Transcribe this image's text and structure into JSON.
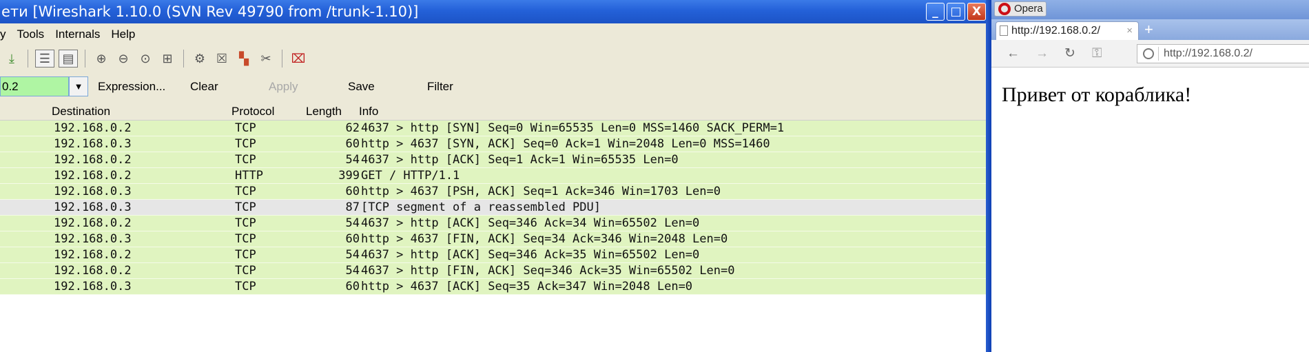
{
  "wireshark": {
    "title": "ети   [Wireshark 1.10.0  (SVN Rev 49790 from /trunk-1.10)]",
    "window_buttons": [
      "_",
      "□",
      "X"
    ],
    "menu": [
      "y",
      "Tools",
      "Internals",
      "Help"
    ],
    "filter": {
      "value": "0.2",
      "buttons": {
        "expression": "Expression...",
        "clear": "Clear",
        "apply": "Apply",
        "save": "Save",
        "filter": "Filter"
      }
    },
    "columns": {
      "destination": "Destination",
      "protocol": "Protocol",
      "length": "Length",
      "info": "Info"
    },
    "packets": [
      {
        "dst": "192.168.0.2",
        "proto": "TCP",
        "len": "62",
        "info": "4637 > http [SYN] Seq=0 Win=65535 Len=0 MSS=1460 SACK_PERM=1"
      },
      {
        "dst": "192.168.0.3",
        "proto": "TCP",
        "len": "60",
        "info": "http > 4637 [SYN, ACK] Seq=0 Ack=1 Win=2048 Len=0 MSS=1460"
      },
      {
        "dst": "192.168.0.2",
        "proto": "TCP",
        "len": "54",
        "info": "4637 > http [ACK] Seq=1 Ack=1 Win=65535 Len=0"
      },
      {
        "dst": "192.168.0.2",
        "proto": "HTTP",
        "len": "399",
        "info": "GET / HTTP/1.1"
      },
      {
        "dst": "192.168.0.3",
        "proto": "TCP",
        "len": "60",
        "info": "http > 4637 [PSH, ACK] Seq=1 Ack=346 Win=1703 Len=0"
      },
      {
        "dst": "192.168.0.3",
        "proto": "TCP",
        "len": "87",
        "info": "[TCP segment of a reassembled PDU]"
      },
      {
        "dst": "192.168.0.2",
        "proto": "TCP",
        "len": "54",
        "info": "4637 > http [ACK] Seq=346 Ack=34 Win=65502 Len=0"
      },
      {
        "dst": "192.168.0.3",
        "proto": "TCP",
        "len": "60",
        "info": "http > 4637 [FIN, ACK] Seq=34 Ack=346 Win=2048 Len=0"
      },
      {
        "dst": "192.168.0.2",
        "proto": "TCP",
        "len": "54",
        "info": "4637 > http [ACK] Seq=346 Ack=35 Win=65502 Len=0"
      },
      {
        "dst": "192.168.0.2",
        "proto": "TCP",
        "len": "54",
        "info": "4637 > http [FIN, ACK] Seq=346 Ack=35 Win=65502 Len=0"
      },
      {
        "dst": "192.168.0.3",
        "proto": "TCP",
        "len": "60",
        "info": "http > 4637 [ACK] Seq=35 Ack=347 Win=2048 Len=0"
      }
    ],
    "colors": {
      "tcp_row": "#e0f4c0",
      "pdu_row": "#e6e6e6",
      "filter_valid": "#aff5a3"
    }
  },
  "opera": {
    "menu_label": "Opera",
    "tab": {
      "title": "http://192.168.0.2/",
      "close": "×",
      "new": "+"
    },
    "address": "http://192.168.0.2/",
    "page_text": "Привет от кораблика!"
  }
}
